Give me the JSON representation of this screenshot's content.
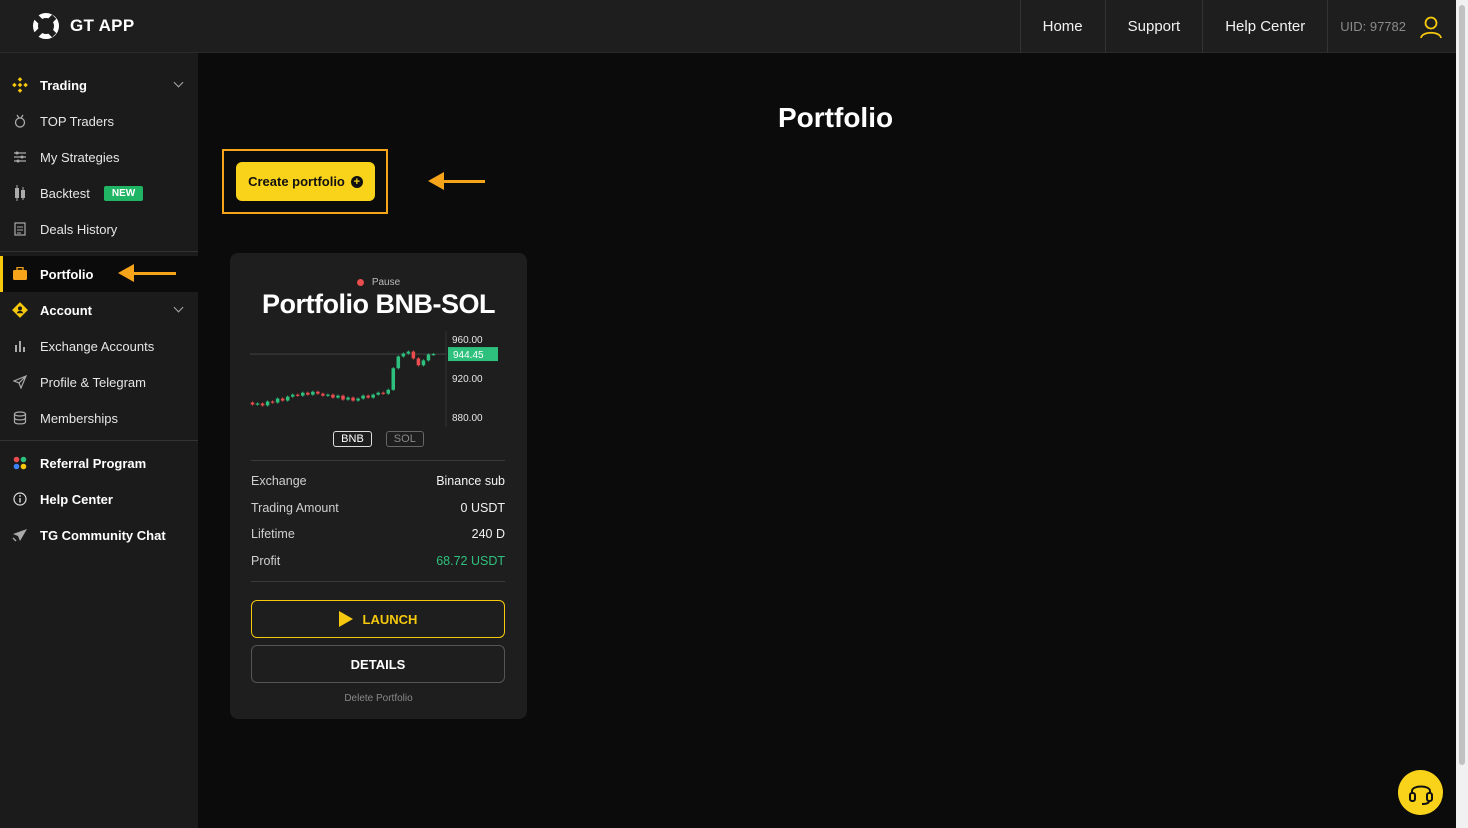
{
  "app": {
    "name": "GT APP"
  },
  "nav": {
    "home": "Home",
    "support": "Support",
    "help_center": "Help Center",
    "uid": "UID: 97782"
  },
  "sidebar": {
    "trading": "Trading",
    "top_traders": "TOP Traders",
    "my_strategies": "My Strategies",
    "backtest": "Backtest",
    "backtest_badge": "NEW",
    "deals_history": "Deals History",
    "portfolio": "Portfolio",
    "account": "Account",
    "exchange_accounts": "Exchange Accounts",
    "profile_telegram": "Profile & Telegram",
    "memberships": "Memberships",
    "referral": "Referral Program",
    "help_center": "Help Center",
    "tg_chat": "TG Community Chat"
  },
  "main": {
    "title": "Portfolio",
    "create_button": "Create portfolio"
  },
  "card": {
    "status": "Pause",
    "title": "Portfolio BNB-SOL",
    "coins": [
      "BNB",
      "SOL"
    ],
    "price_ticks": [
      "960.00",
      "920.00",
      "880.00"
    ],
    "current_price": "944.45",
    "rows": [
      {
        "label": "Exchange",
        "value": "Binance sub"
      },
      {
        "label": "Trading Amount",
        "value": "0 USDT"
      },
      {
        "label": "Lifetime",
        "value": "240 D"
      },
      {
        "label": "Profit",
        "value": "68.72 USDT"
      }
    ],
    "launch": "LAUNCH",
    "details": "DETAILS",
    "delete": "Delete Portfolio"
  },
  "chart_data": {
    "type": "candlestick",
    "ylim": [
      870,
      968
    ],
    "current": 944.45,
    "candles": [
      [
        895,
        893
      ],
      [
        893,
        894
      ],
      [
        894,
        892
      ],
      [
        892,
        896
      ],
      [
        896,
        895
      ],
      [
        895,
        899
      ],
      [
        899,
        897
      ],
      [
        897,
        901
      ],
      [
        901,
        903
      ],
      [
        903,
        902
      ],
      [
        902,
        905
      ],
      [
        905,
        903
      ],
      [
        903,
        906
      ],
      [
        906,
        904
      ],
      [
        904,
        902
      ],
      [
        902,
        903
      ],
      [
        903,
        900
      ],
      [
        900,
        902
      ],
      [
        902,
        898
      ],
      [
        898,
        900
      ],
      [
        900,
        897
      ],
      [
        897,
        899
      ],
      [
        899,
        902
      ],
      [
        902,
        900
      ],
      [
        900,
        903
      ],
      [
        903,
        905
      ],
      [
        905,
        904
      ],
      [
        904,
        908
      ],
      [
        908,
        930
      ],
      [
        930,
        942
      ],
      [
        942,
        945
      ],
      [
        945,
        947
      ],
      [
        947,
        940
      ],
      [
        940,
        933
      ],
      [
        933,
        938
      ],
      [
        938,
        944
      ],
      [
        944,
        944.45
      ]
    ]
  },
  "colors": {
    "accent": "#f9d31a",
    "highlight": "#f6a51a",
    "up": "#2ec07d",
    "down": "#e94d4d"
  }
}
